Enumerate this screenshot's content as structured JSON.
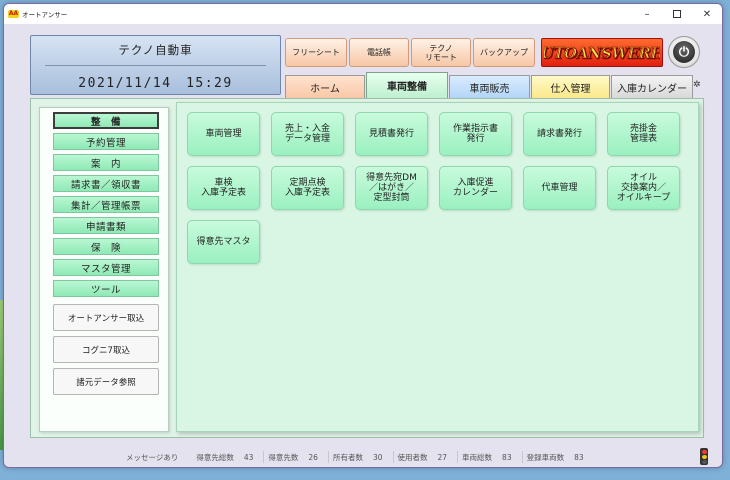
{
  "window": {
    "title": "オートアンサー",
    "app_icon": "AA"
  },
  "header": {
    "company": "テクノ自動車",
    "datetime": "2021/11/14　15:29",
    "buttons": {
      "free_sheet": "フリーシート",
      "phone_book": "電話帳",
      "techno_remote": "テクノ\nリモート",
      "backup": "バックアップ"
    },
    "logo_text": "AUTOANSWERHT",
    "power_icon": "power-icon"
  },
  "tabs": [
    {
      "label": "ホーム",
      "color": "#f8c8a6"
    },
    {
      "label": "車両整備",
      "color": "#bdf0cf",
      "active": true
    },
    {
      "label": "車両販売",
      "color": "#b3d5f7"
    },
    {
      "label": "仕入管理",
      "color": "#fbe98a"
    },
    {
      "label": "入庫カレンダー",
      "color": "#d8d8d8"
    }
  ],
  "sidebar": {
    "items": [
      "整　備",
      "予約管理",
      "案　内",
      "請求書／領収書",
      "集計／管理帳票",
      "申請書類",
      "保　険",
      "マスタ管理",
      "ツール"
    ],
    "buttons": [
      "オートアンサー取込",
      "コグニ7取込",
      "諸元データ参照"
    ]
  },
  "tiles": [
    "車両管理",
    "売上・入金\nデータ管理",
    "見積書発行",
    "作業指示書\n発行",
    "請求書発行",
    "売掛金\n管理表",
    "車検\n入庫予定表",
    "定期点検\n入庫予定表",
    "得意先宛DM\n／はがき／\n定型封筒",
    "入庫促進\nカレンダー",
    "代車管理",
    "オイル\n交換案内／\nオイルキープ",
    "得意先マスタ"
  ],
  "status": {
    "message": "メッセージあり",
    "stats": [
      {
        "label": "得意先総数",
        "value": "43"
      },
      {
        "label": "得意先数",
        "value": "26"
      },
      {
        "label": "所有者数",
        "value": "30"
      },
      {
        "label": "使用者数",
        "value": "27"
      },
      {
        "label": "車両総数",
        "value": "83"
      },
      {
        "label": "登録車両数",
        "value": "83"
      }
    ]
  }
}
